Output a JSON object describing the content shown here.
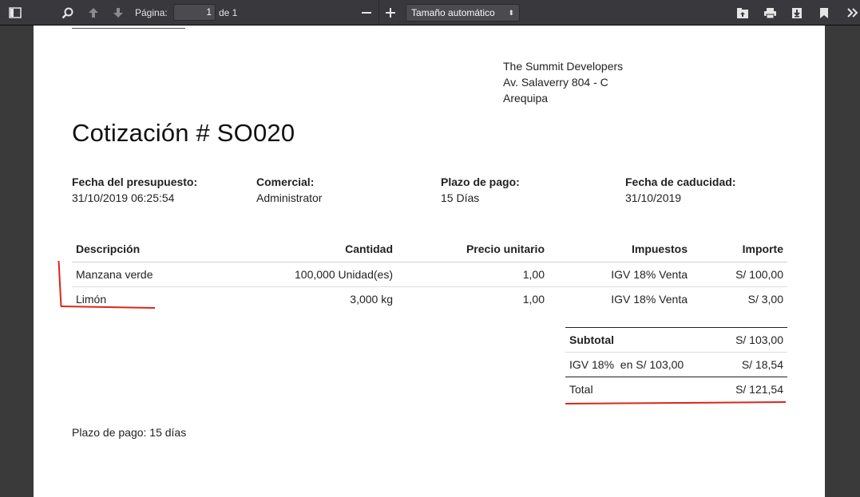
{
  "toolbar": {
    "page_label": "Página:",
    "page_value": "1",
    "page_of": "de 1",
    "zoom_value": "Tamaño automático",
    "icons": [
      "sidebar-toggle-icon",
      "search-icon",
      "arrow-up-icon",
      "arrow-down-icon",
      "minus-icon",
      "plus-icon",
      "presentation-icon",
      "print-icon",
      "download-icon",
      "bookmark-icon",
      "double-chevron-right-icon"
    ]
  },
  "company": {
    "name": "The Summit Developers",
    "street": "Av. Salaverry 804 - C",
    "city": "Arequipa"
  },
  "document": {
    "title": "Cotización # SO020"
  },
  "info": [
    {
      "label": "Fecha del presupuesto:",
      "value": "31/10/2019 06:25:54"
    },
    {
      "label": "Comercial:",
      "value": "Administrator"
    },
    {
      "label": "Plazo de pago:",
      "value": "15 Días"
    },
    {
      "label": "Fecha de caducidad:",
      "value": "31/10/2019"
    }
  ],
  "lines": {
    "headers": [
      "Descripción",
      "Cantidad",
      "Precio unitario",
      "Impuestos",
      "Importe"
    ],
    "rows": [
      [
        "Manzana verde",
        "100,000 Unidad(es)",
        "1,00",
        "IGV 18% Venta",
        "S/ 100,00"
      ],
      [
        "Limón",
        "3,000 kg",
        "1,00",
        "IGV 18% Venta",
        "S/ 3,00"
      ]
    ]
  },
  "totals": {
    "subtotal_label": "Subtotal",
    "subtotal_value": "S/ 103,00",
    "tax_label": "IGV 18%  en S/ 103,00",
    "tax_value": "S/ 18,54",
    "total_label": "Total",
    "total_value": "S/ 121,54"
  },
  "terms": "Plazo de pago: 15 días",
  "colors": {
    "toolbar_bg": "#38383d",
    "viewer_bg": "#3a3a3a",
    "annotation": "#d9261c"
  }
}
